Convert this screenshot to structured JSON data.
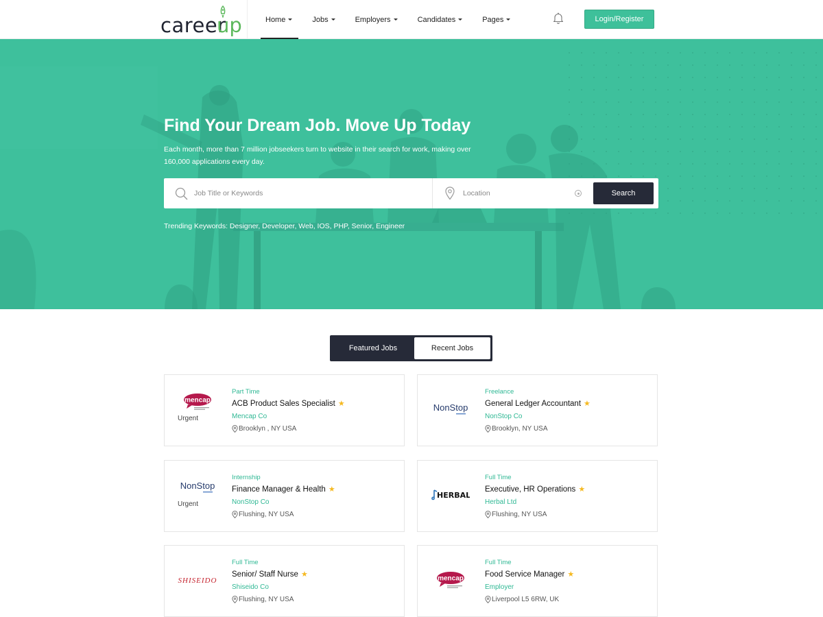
{
  "header": {
    "logo_text": "career",
    "logo_accent": "up",
    "nav": [
      {
        "label": "Home"
      },
      {
        "label": "Jobs"
      },
      {
        "label": "Employers"
      },
      {
        "label": "Candidates"
      },
      {
        "label": "Pages"
      }
    ],
    "login_label": "Login/Register"
  },
  "hero": {
    "title": "Find Your Dream Job. Move Up Today",
    "subtitle": "Each month, more than 7 million jobseekers turn to website in their search for work, making over 160,000 applications every day.",
    "keyword_placeholder": "Job Title or Keywords",
    "location_placeholder": "Location",
    "search_label": "Search",
    "trending": "Trending Keywords: Designer, Developer, Web, IOS, PHP, Senior, Engineer"
  },
  "tabs": {
    "featured": "Featured Jobs",
    "recent": "Recent Jobs"
  },
  "jobs": [
    {
      "type": "Part Time",
      "title": "ACB Product Sales Specialist",
      "company": "Mencap Co",
      "location": "Brooklyn , NY USA",
      "urgent": "Urgent",
      "logo": "mencap",
      "logo_text": "mencap"
    },
    {
      "type": "Freelance",
      "title": "General Ledger Accountant",
      "company": "NonStop Co",
      "location": "Brooklyn, NY USA",
      "urgent": "",
      "logo": "nonstop",
      "logo_text": "NonStop"
    },
    {
      "type": "Internship",
      "title": "Finance Manager & Health",
      "company": "NonStop Co",
      "location": "Flushing, NY USA",
      "urgent": "Urgent",
      "logo": "nonstop",
      "logo_text": "NonStop"
    },
    {
      "type": "Full Time",
      "title": "Executive, HR Operations",
      "company": "Herbal Ltd",
      "location": "Flushing, NY USA",
      "urgent": "",
      "logo": "herbal",
      "logo_text": "HERBAL"
    },
    {
      "type": "Full Time",
      "title": "Senior/ Staff Nurse",
      "company": "Shiseido Co",
      "location": "Flushing, NY USA",
      "urgent": "",
      "logo": "shiseido",
      "logo_text": "SHISEIDO"
    },
    {
      "type": "Full Time",
      "title": "Food Service Manager",
      "company": "Employer",
      "location": "Liverpool L5 6RW, UK",
      "urgent": "",
      "logo": "mencap",
      "logo_text": "mencap"
    }
  ],
  "colors": {
    "accent": "#3ec09c",
    "dark": "#262a38",
    "star": "#f5b921"
  }
}
